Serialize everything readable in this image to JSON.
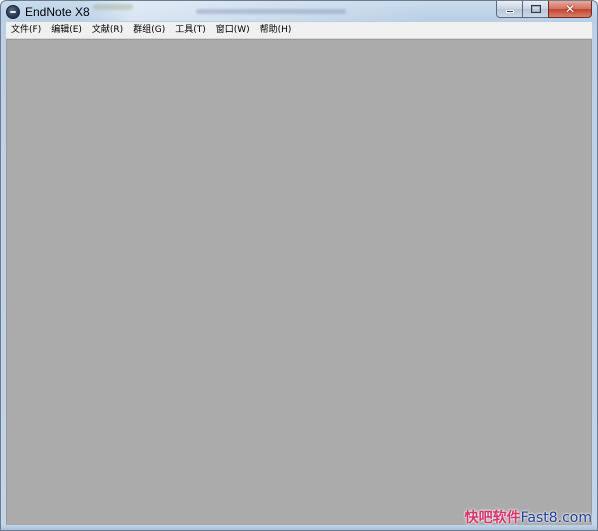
{
  "window": {
    "title": "EndNote X8",
    "app_icon": "endnote-icon",
    "caption_buttons": {
      "minimize_icon": "minimize-icon",
      "maximize_icon": "maximize-icon",
      "close_icon": "close-icon",
      "close_glyph": "✕"
    }
  },
  "menubar": {
    "items": [
      {
        "label": "文件(F)"
      },
      {
        "label": "编辑(E)"
      },
      {
        "label": "文献(R)"
      },
      {
        "label": "群组(G)"
      },
      {
        "label": "工具(T)"
      },
      {
        "label": "窗口(W)"
      },
      {
        "label": "帮助(H)"
      }
    ]
  },
  "client_area": {
    "background_color": "#ababab"
  },
  "watermark": {
    "cn_text": "快吧软件",
    "en_text": "Fast8.com"
  },
  "colors": {
    "close_button": "#c2432f",
    "frame": "#bcd1e7",
    "watermark_cn": "#d6336c",
    "watermark_en": "#1d3f9a"
  }
}
